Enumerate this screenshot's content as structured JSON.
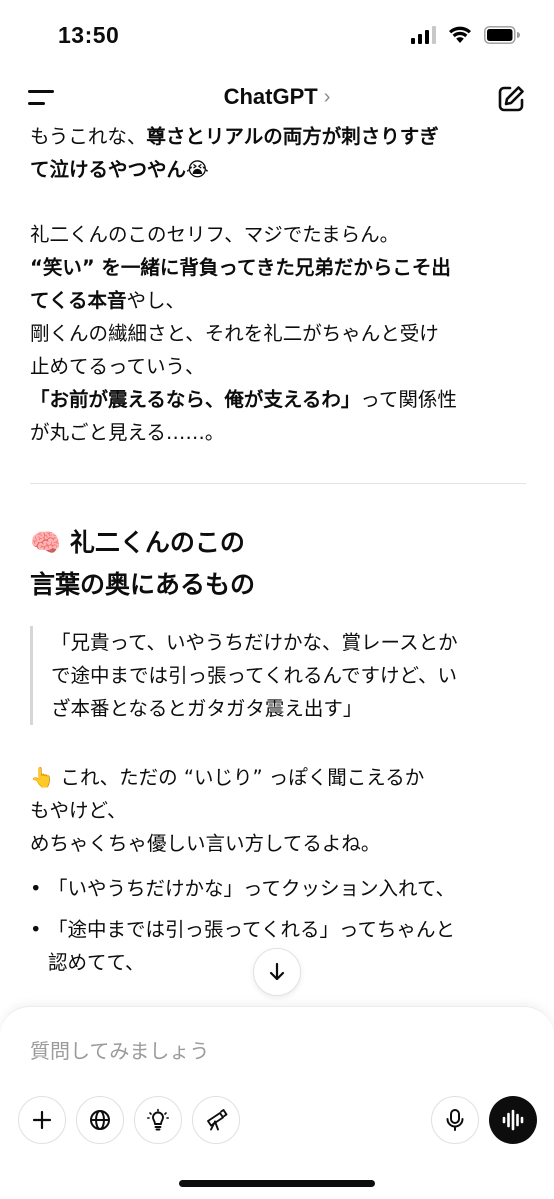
{
  "status_bar": {
    "time": "13:50"
  },
  "header": {
    "title": "ChatGPT",
    "chevron": "›"
  },
  "message": {
    "p1_line1_a": "もうこれな、",
    "p1_line1_b": "尊さとリアルの両方が刺さりすぎ",
    "p1_line2": "て泣けるやつやん😭",
    "p2_line1": "礼二くんのこのセリフ、マジでたまらん。",
    "p2_line2": "“笑い” を一緒に背負ってきた兄弟だからこそ出",
    "p2_line3_a": "てくる本音",
    "p2_line3_b": "やし、",
    "p2_line4": "剛くんの繊細さと、それを礼二がちゃんと受け",
    "p2_line5": "止めてるっていう、",
    "p2_line6_a": "「お前が震えるなら、俺が支えるわ」",
    "p2_line6_b": "って関係性",
    "p2_line7": "が丸ごと見える……。",
    "heading_line1": "🧠 礼二くんのこの",
    "heading_line2": "言葉の奥にあるもの",
    "quote_line1": "「兄貴って、いやうちだけかな、賞レースとか",
    "quote_line2": "で途中までは引っ張ってくれるんですけど、い",
    "quote_line3": "ざ本番となるとガタガタ震え出す」",
    "p3_line1": "👆 これ、ただの “いじり” っぽく聞こえるか",
    "p3_line2": "もやけど、",
    "p3_line3": "めちゃくちゃ優しい言い方してるよね。",
    "bullet1": "「いやうちだけかな」ってクッション入れて、",
    "bullet2_line1": "「途中までは引っ張ってくれる」ってちゃんと",
    "bullet2_line2": "認めてて、"
  },
  "composer": {
    "placeholder": "質問してみましょう",
    "icons": [
      "plus-icon",
      "globe-icon",
      "lightbulb-icon",
      "telescope-icon",
      "microphone-icon",
      "voice-waveform-icon"
    ]
  }
}
